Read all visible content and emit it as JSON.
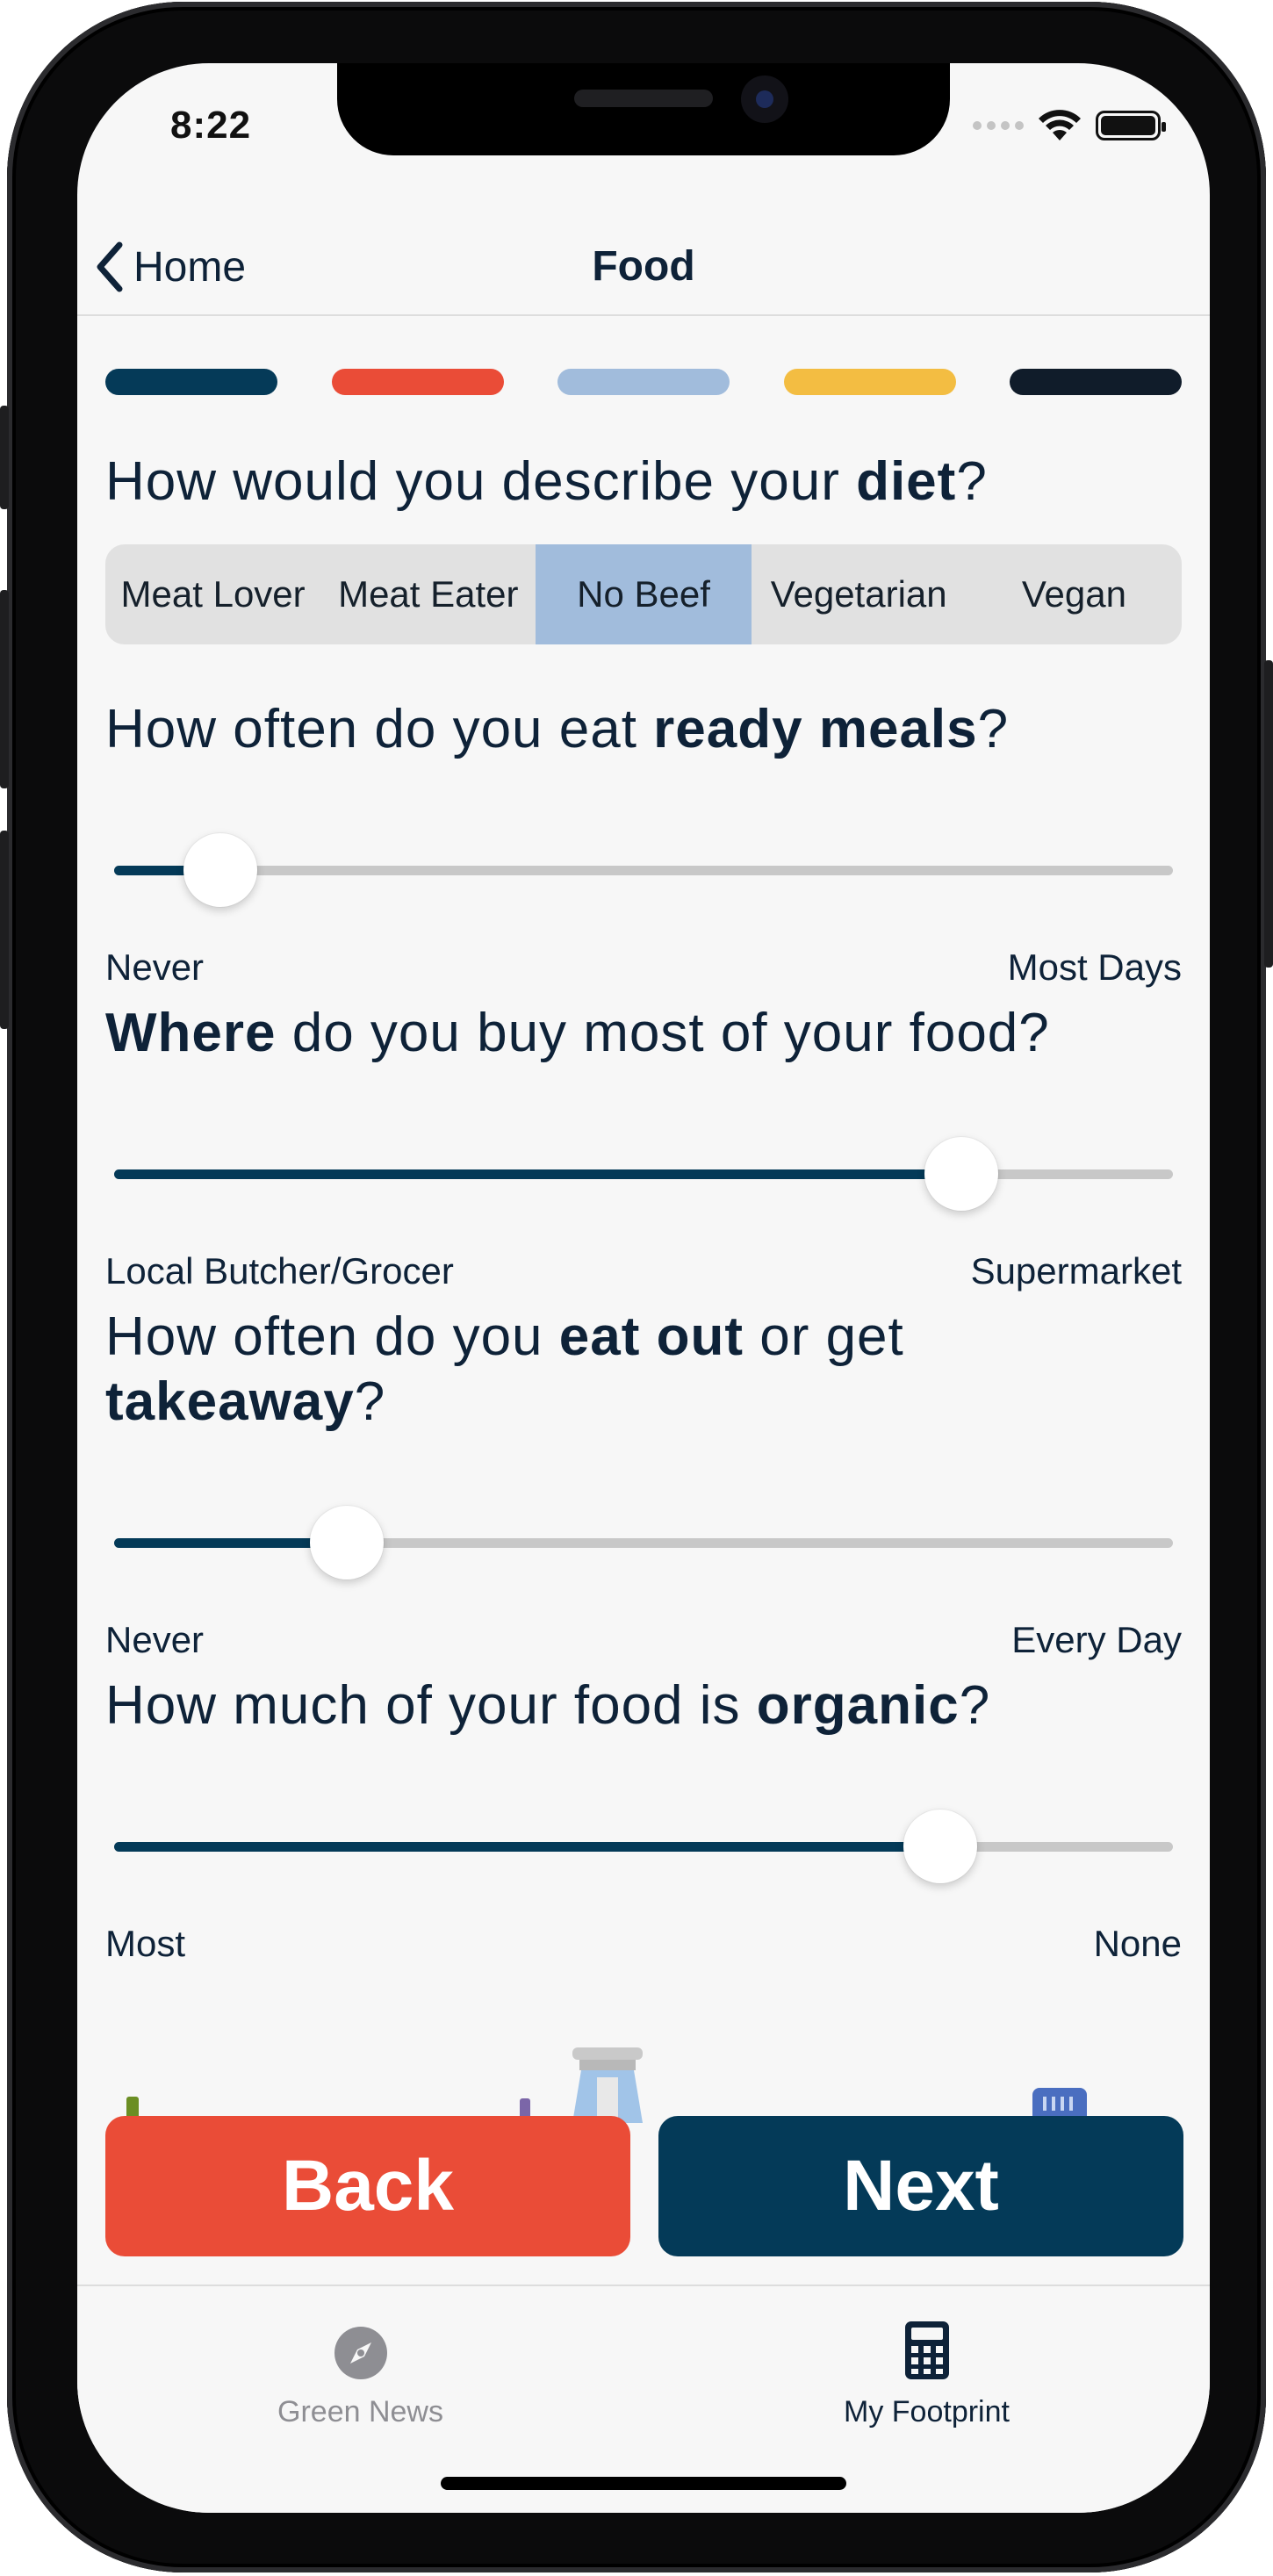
{
  "status_bar": {
    "time": "8:22"
  },
  "nav": {
    "back_label": "Home",
    "title": "Food"
  },
  "progress": {
    "colors": [
      "#053a58",
      "#ea4c37",
      "#a1bcdc",
      "#f3bd42",
      "#101c2a"
    ]
  },
  "diet": {
    "q_pre": "How would you describe your ",
    "q_bold": "diet",
    "q_post": "?",
    "options": [
      "Meat Lover",
      "Meat Eater",
      "No Beef",
      "Vegetarian",
      "Vegan"
    ],
    "selected": "No Beef"
  },
  "ready_meals": {
    "q_pre": "How often do you eat ",
    "q_bold": "ready meals",
    "q_post": "?",
    "min_label": "Never",
    "max_label": "Most Days",
    "value_fraction": 0.1
  },
  "where_buy": {
    "q_bold": "Where",
    "q_post": " do you buy most of your food?",
    "min_label": "Local Butcher/Grocer",
    "max_label": "Supermarket",
    "value_fraction": 0.8
  },
  "eat_out": {
    "q_pre": "How often do you ",
    "q_bold1": "eat out",
    "q_mid": " or get ",
    "q_bold2": "takeaway",
    "q_post": "?",
    "min_label": "Never",
    "max_label": "Every Day",
    "value_fraction": 0.22
  },
  "organic": {
    "q_pre": "How much of your food is ",
    "q_bold": "organic",
    "q_post": "?",
    "min_label": "Most",
    "max_label": "None",
    "value_fraction": 0.78
  },
  "actions": {
    "back": "Back",
    "next": "Next"
  },
  "tabbar": {
    "items": [
      {
        "label": "Green News",
        "icon": "compass-icon",
        "active": false
      },
      {
        "label": "My Footprint",
        "icon": "calculator-icon",
        "active": true
      }
    ],
    "active_color": "#0e2238",
    "inactive_color": "#8e8e93"
  }
}
